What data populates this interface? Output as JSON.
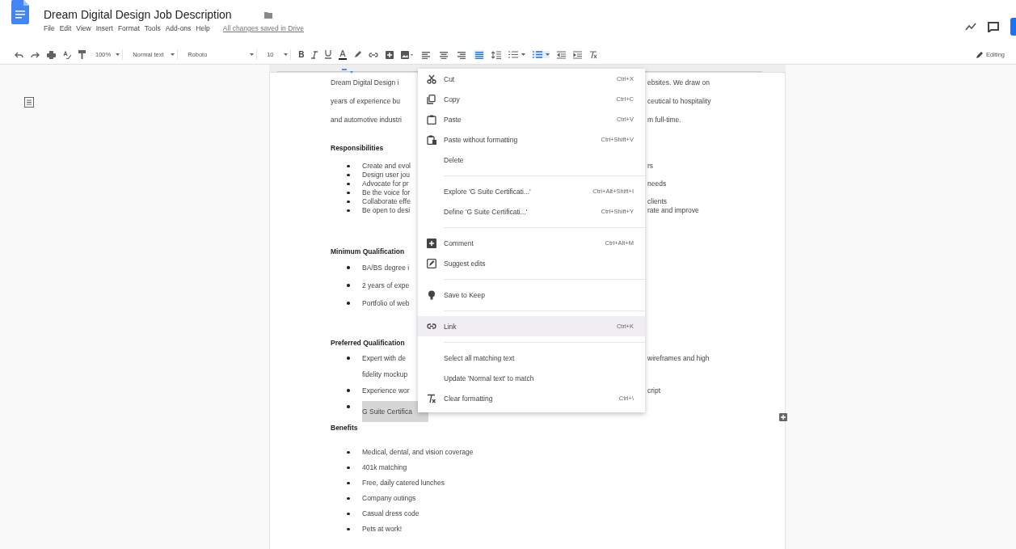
{
  "header": {
    "title": "Dream Digital Design Job Description",
    "menus": [
      "File",
      "Edit",
      "View",
      "Insert",
      "Format",
      "Tools",
      "Add-ons",
      "Help"
    ],
    "save_status": "All changes saved in Drive"
  },
  "toolbar": {
    "bold": "B",
    "zoom": "100%",
    "style": "Normal text",
    "font": "Roboto",
    "font_size": "10",
    "alignment": [
      {
        "selected": false
      },
      {
        "selected": false
      },
      {
        "selected": false
      },
      {
        "selected": true
      }
    ],
    "lists": [
      {
        "selected": false
      },
      {
        "selected": true
      }
    ],
    "mode": "Editing"
  },
  "document": {
    "paragraph": [
      {
        "left": "Dream Digital Design i",
        "right": "ebsites.  We draw on"
      },
      {
        "left": "years of experience bu",
        "right": "ceutical to hospitality"
      },
      {
        "left": "and automotive industri",
        "right": "m full-time."
      }
    ],
    "sections": [
      {
        "heading": "Responsibilities",
        "items": [
          {
            "left": "Create and evol",
            "right": "rs",
            "selected": false
          },
          {
            "left": "Design user jou",
            "selected": false
          },
          {
            "left": "Advocate for pr",
            "right": "needs",
            "selected": false
          },
          {
            "left": "Be the voice for",
            "selected": false
          },
          {
            "left": "Collaborate effe",
            "right": "clients",
            "selected": false
          },
          {
            "left": "Be open to desi",
            "right": "rate and improve",
            "selected": false
          }
        ]
      },
      {
        "heading": "Minimum Qualification",
        "items": [
          {
            "left": "BA/BS degree i",
            "selected": false
          },
          {
            "left": "2 years of expe",
            "selected": false
          },
          {
            "left": "Portfolio of web",
            "selected": false
          }
        ]
      },
      {
        "heading": "Preferred Qualification",
        "items": [
          {
            "left": "Expert with de",
            "right": "wireframes and high",
            "continued": "fidelity mockup",
            "selected": false
          },
          {
            "left": "Experience wor",
            "right": "cript",
            "selected": false
          },
          {
            "left": "G Suite Certifica",
            "selected": true
          }
        ]
      },
      {
        "heading": "Benefits",
        "items": [
          {
            "left": "Medical, dental, and vision coverage",
            "selected": false
          },
          {
            "left": "401k matching",
            "selected": false
          },
          {
            "left": "Free, daily catered lunches",
            "selected": false
          },
          {
            "left": "Company outings",
            "selected": false
          },
          {
            "left": "Casual dress code",
            "selected": false
          },
          {
            "left": "Pets at work!",
            "selected": false
          }
        ]
      }
    ]
  },
  "context_menu": {
    "groups": [
      [
        {
          "label": "Cut",
          "shortcut": "Ctrl+X",
          "selected": false
        },
        {
          "label": "Copy",
          "shortcut": "Ctrl+C",
          "selected": false
        },
        {
          "label": "Paste",
          "shortcut": "Ctrl+V",
          "selected": false
        },
        {
          "label": "Paste without formatting",
          "shortcut": "Ctrl+Shift+V",
          "selected": false
        },
        {
          "label": "Delete",
          "selected": false
        }
      ],
      [
        {
          "label": "Explore 'G Suite Certificati...'",
          "shortcut": "Ctrl+Alt+Shift+I",
          "selected": false
        },
        {
          "label": "Define 'G Suite Certificati...'",
          "shortcut": "Ctrl+Shift+Y",
          "selected": false
        }
      ],
      [
        {
          "label": "Comment",
          "shortcut": "Ctrl+Alt+M",
          "selected": false
        },
        {
          "label": "Suggest edits",
          "selected": false
        }
      ],
      [
        {
          "label": "Save to Keep",
          "selected": false
        }
      ],
      [
        {
          "label": "Link",
          "shortcut": "Ctrl+K",
          "selected": true
        }
      ],
      [
        {
          "label": "Select all matching text",
          "selected": false
        },
        {
          "label": "Update 'Normal text' to match",
          "selected": false
        },
        {
          "label": "Clear formatting",
          "shortcut": "Ctrl+\\",
          "selected": false
        }
      ]
    ]
  }
}
